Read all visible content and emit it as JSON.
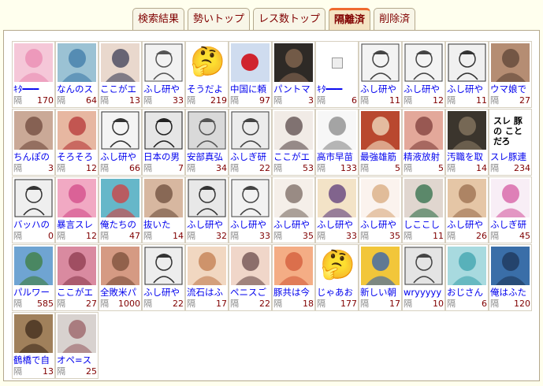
{
  "tabs": [
    {
      "label": "検索結果",
      "active": false
    },
    {
      "label": "勢いトップ",
      "active": false
    },
    {
      "label": "レス数トップ",
      "active": false
    },
    {
      "label": "隔離済",
      "active": true
    },
    {
      "label": "削除済",
      "active": false
    }
  ],
  "count_label": "隔",
  "threads": [
    {
      "title": "ｷﾀ━━━",
      "count": 170,
      "icon": "pink-anime-girl",
      "bg": "#f5c7d8",
      "fg": "#e98ab2"
    },
    {
      "title": "なんのス",
      "count": 64,
      "icon": "blue-mascot",
      "bg": "#9bc2d4",
      "fg": "#3d79a8"
    },
    {
      "title": "ここがエ",
      "count": 13,
      "icon": "anime-illustration",
      "bg": "#e9d8cd",
      "fg": "#3b3d56"
    },
    {
      "title": "ふし研や",
      "count": 33,
      "icon": "manga-panel",
      "bg": "#f2f2f2",
      "fg": "#555"
    },
    {
      "title": "そうだよ",
      "count": 219,
      "icon": "thinking-emoji",
      "bg": "#ffffff",
      "fg": "#f5c431",
      "emoji": "🤔"
    },
    {
      "title": "中国に頼",
      "count": 97,
      "icon": "japan-flag",
      "bg": "#cfdcef",
      "fg": "#d0242e"
    },
    {
      "title": "パントマ",
      "count": 3,
      "icon": "dark-photo",
      "bg": "#2e2a26",
      "fg": "#8a6b53"
    },
    {
      "title": "ｷﾀ━━━",
      "count": 6,
      "icon": "broken-image",
      "bg": "#ffffff",
      "fg": "#999"
    },
    {
      "title": "ふし研や",
      "count": 11,
      "icon": "manga-panel",
      "bg": "#f3f3f3",
      "fg": "#444"
    },
    {
      "title": "ふし研や",
      "count": 12,
      "icon": "manga-panel",
      "bg": "#f3f3f3",
      "fg": "#444"
    },
    {
      "title": "ふし研や",
      "count": 11,
      "icon": "manga-panel",
      "bg": "#f0f0f0",
      "fg": "#333"
    },
    {
      "title": "ウマ娘で",
      "count": 27,
      "icon": "photo",
      "bg": "#b58d73",
      "fg": "#5e4436"
    },
    {
      "title": "ちんぽの",
      "count": 3,
      "icon": "anime-illustration",
      "bg": "#caa997",
      "fg": "#6f4a3c"
    },
    {
      "title": "そろそろ",
      "count": 12,
      "icon": "anime-illustration",
      "bg": "#e7b7a1",
      "fg": "#b63537"
    },
    {
      "title": "ふし研や",
      "count": 66,
      "icon": "manga-panel",
      "bg": "#f4f4f4",
      "fg": "#333"
    },
    {
      "title": "日本の男",
      "count": 7,
      "icon": "manga-panel",
      "bg": "#e6e6e6",
      "fg": "#222"
    },
    {
      "title": "安部真弘",
      "count": 34,
      "icon": "manga-panel",
      "bg": "#d9d9d9",
      "fg": "#555"
    },
    {
      "title": "ふしぎ研",
      "count": 22,
      "icon": "manga-panel",
      "bg": "#ececec",
      "fg": "#444"
    },
    {
      "title": "ここがエ",
      "count": 53,
      "icon": "anime-illustration",
      "bg": "#f1ebe6",
      "fg": "#5a4a4a"
    },
    {
      "title": "高市早苗",
      "count": 133,
      "icon": "document-image",
      "bg": "#f7f7f7",
      "fg": "#888"
    },
    {
      "title": "最強雄筋",
      "count": 5,
      "icon": "book-cover",
      "bg": "#b9482f",
      "fg": "#f3e2c6"
    },
    {
      "title": "精液放射",
      "count": 5,
      "icon": "anime-illustration",
      "bg": "#e3a89a",
      "fg": "#7f3d3a"
    },
    {
      "title": "汚職を取",
      "count": 14,
      "icon": "photo",
      "bg": "#3b352d",
      "fg": "#8b7a63"
    },
    {
      "title": "スレ豚連",
      "count": 234,
      "icon": "text-image",
      "bg": "#ffffff",
      "fg": "#000",
      "text": "スレ 豚の ことだろ"
    },
    {
      "title": "バッハの",
      "count": 0,
      "icon": "manga-panel",
      "bg": "#efefef",
      "fg": "#333"
    },
    {
      "title": "暴言スレ",
      "count": 12,
      "icon": "anime-illustration",
      "bg": "#f1a9c3",
      "fg": "#d24b88"
    },
    {
      "title": "俺たちの",
      "count": 47,
      "icon": "clown-illustration",
      "bg": "#66b7c9",
      "fg": "#d43d3d"
    },
    {
      "title": "抜いた",
      "count": 14,
      "icon": "anime-illustration",
      "bg": "#d7b7a0",
      "fg": "#6d4e3c"
    },
    {
      "title": "ふし研や",
      "count": 32,
      "icon": "manga-panel",
      "bg": "#e8e8e8",
      "fg": "#333"
    },
    {
      "title": "ふし研や",
      "count": 33,
      "icon": "manga-panel",
      "bg": "#f2f2f2",
      "fg": "#444"
    },
    {
      "title": "ふし研や",
      "count": 35,
      "icon": "anime-illustration",
      "bg": "#f5efe9",
      "fg": "#7a6a62"
    },
    {
      "title": "ふし研や",
      "count": 33,
      "icon": "cartoon-illustration",
      "bg": "#f3e3c7",
      "fg": "#5b3a7a"
    },
    {
      "title": "ふし研や",
      "count": 35,
      "icon": "anime-illustration",
      "bg": "#fbf3ee",
      "fg": "#d8a97c"
    },
    {
      "title": "しここし",
      "count": 11,
      "icon": "anime-illustration",
      "bg": "#e0d6cf",
      "fg": "#2f6e48"
    },
    {
      "title": "ふし研や",
      "count": 26,
      "icon": "photo",
      "bg": "#e5c6a6",
      "fg": "#9a6e4e"
    },
    {
      "title": "ふしぎ研",
      "count": 45,
      "icon": "anime-illustration",
      "bg": "#f8eef6",
      "fg": "#d65ba2"
    },
    {
      "title": "パルワー",
      "count": 585,
      "icon": "game-screenshot",
      "bg": "#6fa4d2",
      "fg": "#3e7d3c"
    },
    {
      "title": "ここがエ",
      "count": 27,
      "icon": "anime-illustration",
      "bg": "#d98aa0",
      "fg": "#8c3a4e"
    },
    {
      "title": "全敗米パ",
      "count": 1000,
      "icon": "photo",
      "bg": "#d59a83",
      "fg": "#7a4d38"
    },
    {
      "title": "ふし研や",
      "count": 22,
      "icon": "manga-panel",
      "bg": "#ededed",
      "fg": "#333"
    },
    {
      "title": "流石はふ",
      "count": 17,
      "icon": "anime-illustration",
      "bg": "#f1d7c1",
      "fg": "#c27c4e"
    },
    {
      "title": "ペニスご",
      "count": 22,
      "icon": "cartoon-illustration",
      "bg": "#f0d6c9",
      "fg": "#6b4b4b"
    },
    {
      "title": "豚共は今",
      "count": 18,
      "icon": "anime-illustration",
      "bg": "#f4ad85",
      "fg": "#d35b3a"
    },
    {
      "title": "じゃあお",
      "count": 177,
      "icon": "thinking-emoji",
      "bg": "#ffffff",
      "fg": "#f5c431",
      "emoji": "🤔"
    },
    {
      "title": "新しい朝",
      "count": 17,
      "icon": "cartoon-illustration",
      "bg": "#f2c63a",
      "fg": "#2f5fb3"
    },
    {
      "title": "wryyyyy",
      "count": 10,
      "icon": "manga-panel",
      "bg": "#e4e4e4",
      "fg": "#444"
    },
    {
      "title": "おじさん",
      "count": 6,
      "icon": "anime-illustration",
      "bg": "#a8dadf",
      "fg": "#3da3ad"
    },
    {
      "title": "俺はふた",
      "count": 120,
      "icon": "anime-illustration",
      "bg": "#3a6ea8",
      "fg": "#1d3658"
    },
    {
      "title": "鶴橋で自",
      "count": 13,
      "icon": "food-photo",
      "bg": "#a0805b",
      "fg": "#3d2a1a"
    },
    {
      "title": "オペ=ス",
      "count": 25,
      "icon": "anime-illustration",
      "bg": "#d8d2cf",
      "fg": "#9a5f64"
    }
  ]
}
